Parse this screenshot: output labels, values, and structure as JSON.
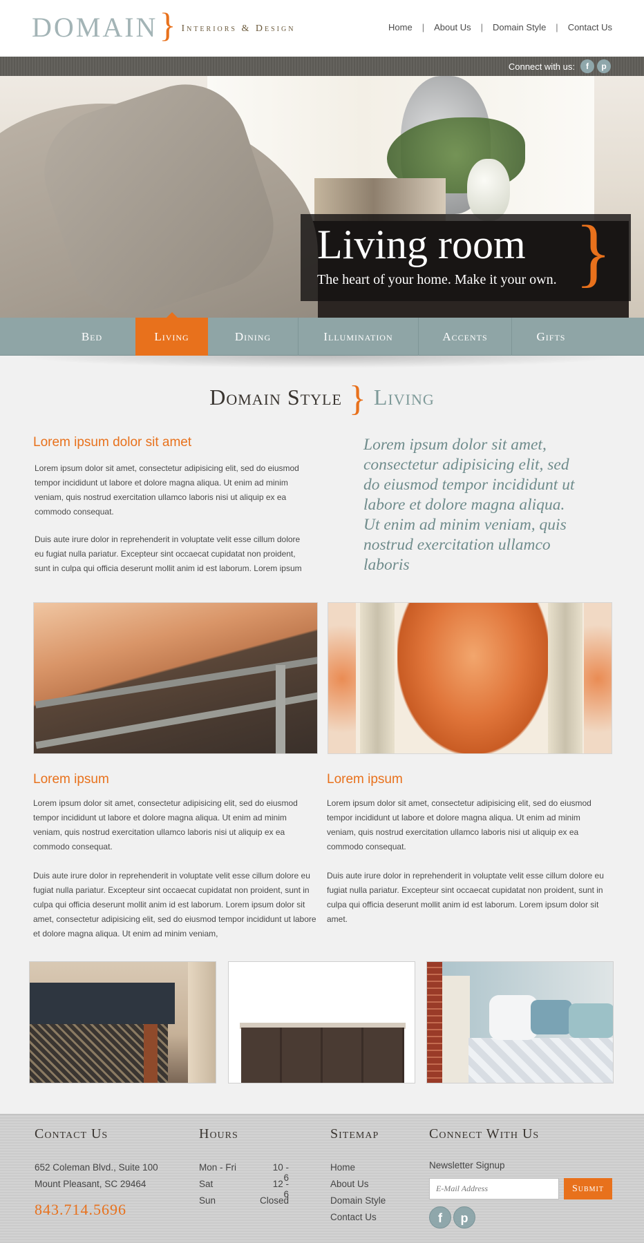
{
  "brand": {
    "logo_word": "DOMAIN",
    "tagline": "Interiors & Design"
  },
  "topnav": [
    "Home",
    "About Us",
    "Domain Style",
    "Contact Us"
  ],
  "connect": {
    "label": "Connect with us:",
    "icons": [
      "facebook-icon",
      "pinterest-icon"
    ]
  },
  "hero": {
    "title": "Living room",
    "subtitle": "The heart of your home. Make it your own."
  },
  "categories": [
    "Bed",
    "Living",
    "Dining",
    "Illumination",
    "Accents",
    "Gifts"
  ],
  "active_category": "Living",
  "section": {
    "title_a": "Domain Style",
    "title_b": "Living"
  },
  "intro": {
    "heading": "Lorem ipsum dolor sit amet",
    "p1": "Lorem ipsum dolor sit amet, consectetur adipisicing elit, sed do eiusmod tempor incididunt ut labore et dolore magna aliqua. Ut enim ad minim veniam, quis nostrud exercitation ullamco laboris nisi ut aliquip ex ea commodo consequat.",
    "p2": "Duis aute irure dolor in reprehenderit in voluptate velit esse cillum dolore eu fugiat nulla pariatur. Excepteur sint occaecat cupidatat non proident, sunt in culpa qui officia deserunt mollit anim id est laborum. Lorem ipsum",
    "quote": "Lorem ipsum dolor sit amet, consectetur adipisicing elit, sed do eiusmod tempor incididunt ut labore et dolore magna aliqua. Ut enim ad minim veniam, quis nostrud exercitation ullamco laboris"
  },
  "columns": [
    {
      "heading": "Lorem ipsum",
      "p1": "Lorem ipsum dolor sit amet, consectetur adipisicing elit, sed do eiusmod tempor incididunt ut labore et dolore magna aliqua. Ut enim ad minim veniam, quis nostrud exercitation ullamco laboris nisi ut aliquip ex ea commodo consequat.",
      "p2": "Duis aute irure dolor in reprehenderit in voluptate velit esse cillum dolore eu fugiat nulla pariatur. Excepteur sint occaecat cupidatat non proident, sunt in culpa qui officia deserunt mollit anim id est laborum. Lorem ipsum dolor sit amet, consectetur adipisicing elit, sed do eiusmod tempor incididunt ut labore et dolore magna aliqua. Ut enim ad minim veniam,"
    },
    {
      "heading": "Lorem ipsum",
      "p1": "Lorem ipsum dolor sit amet, consectetur adipisicing elit, sed do eiusmod tempor incididunt ut labore et dolore magna aliqua. Ut enim ad minim veniam, quis nostrud exercitation ullamco laboris nisi ut aliquip ex ea commodo consequat.",
      "p2": "Duis aute irure dolor in reprehenderit in voluptate velit esse cillum dolore eu fugiat nulla pariatur. Excepteur sint occaecat cupidatat non proident, sunt in culpa qui officia deserunt mollit anim id est laborum. Lorem ipsum dolor sit amet."
    }
  ],
  "footer": {
    "contact": {
      "heading": "Contact Us",
      "address1": "652 Coleman Blvd., Suite 100",
      "address2": "Mount Pleasant, SC 29464",
      "phone": "843.714.5696"
    },
    "hours": {
      "heading": "Hours",
      "rows": [
        {
          "day": "Mon - Fri",
          "time": "10 - 6"
        },
        {
          "day": "Sat",
          "time": "12 - 6"
        },
        {
          "day": "Sun",
          "time": "Closed"
        }
      ]
    },
    "sitemap": {
      "heading": "Sitemap",
      "links": [
        "Home",
        "About Us",
        "Domain Style",
        "Contact Us"
      ]
    },
    "connect": {
      "heading": "Connect With Us",
      "newsletter_label": "Newsletter Signup",
      "email_placeholder": "E-Mail Address",
      "submit_label": "Submit"
    }
  },
  "colors": {
    "accent": "#e8711c",
    "nav": "#8fa5a6",
    "quote": "#6f8c8c"
  }
}
